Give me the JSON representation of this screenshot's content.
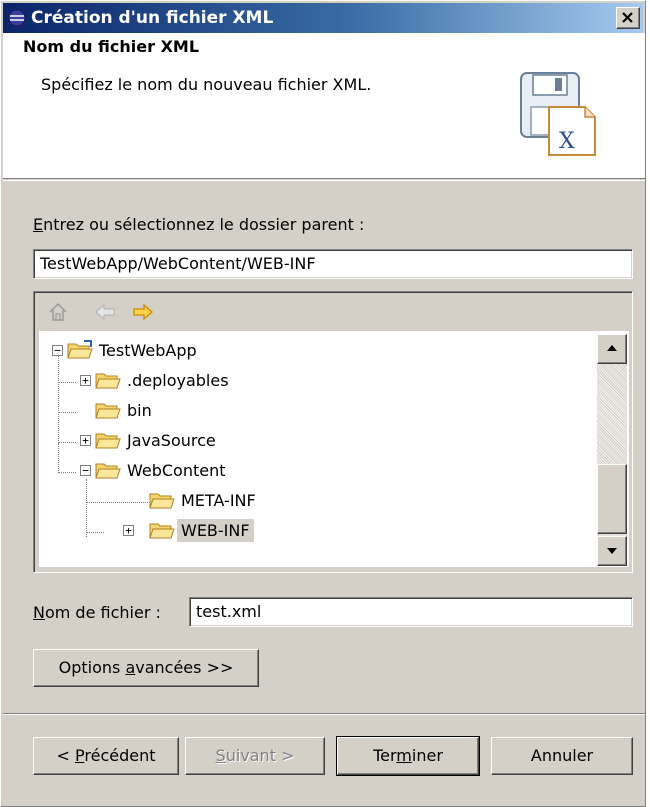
{
  "window": {
    "title": "Création d'un fichier XML",
    "close_symbol": "✕"
  },
  "banner": {
    "title": "Nom du fichier XML",
    "description": "Spécifiez le nom du nouveau fichier XML.",
    "icon_glyph": "X"
  },
  "parent_folder": {
    "label_accel": "E",
    "label_rest": "ntrez ou sélectionnez le dossier parent :",
    "value": "TestWebApp/WebContent/WEB-INF"
  },
  "tree": {
    "toolbar": {
      "home_icon": "home-icon",
      "back_icon": "back-arrow-icon",
      "forward_icon": "forward-arrow-icon"
    },
    "nodes": [
      {
        "label": "TestWebApp",
        "expander": "−"
      },
      {
        "label": ".deployables",
        "expander": "+"
      },
      {
        "label": "bin",
        "expander": ""
      },
      {
        "label": "JavaSource",
        "expander": "+"
      },
      {
        "label": "WebContent",
        "expander": "−"
      },
      {
        "label": "META-INF",
        "expander": ""
      },
      {
        "label": "WEB-INF",
        "expander": "+",
        "selected": true
      }
    ]
  },
  "filename": {
    "label_accel": "N",
    "label_rest": "om de fichier :",
    "value": "test.xml"
  },
  "advanced_button": {
    "pre": "Options ",
    "accel": "a",
    "post": "vancées >>"
  },
  "buttons": {
    "back": {
      "pre": "< ",
      "accel": "P",
      "post": "récédent"
    },
    "next": {
      "accel": "S",
      "post": "uivant >"
    },
    "finish": {
      "pre": "Ter",
      "accel": "m",
      "post": "iner"
    },
    "cancel": "Annuler"
  },
  "colors": {
    "titlebar_start": "#0a246a",
    "titlebar_end": "#a6caf0",
    "dialog_bg": "#d4d0c8",
    "folder_yellow": "#f5d56b",
    "forward_arrow": "#f0b030"
  }
}
